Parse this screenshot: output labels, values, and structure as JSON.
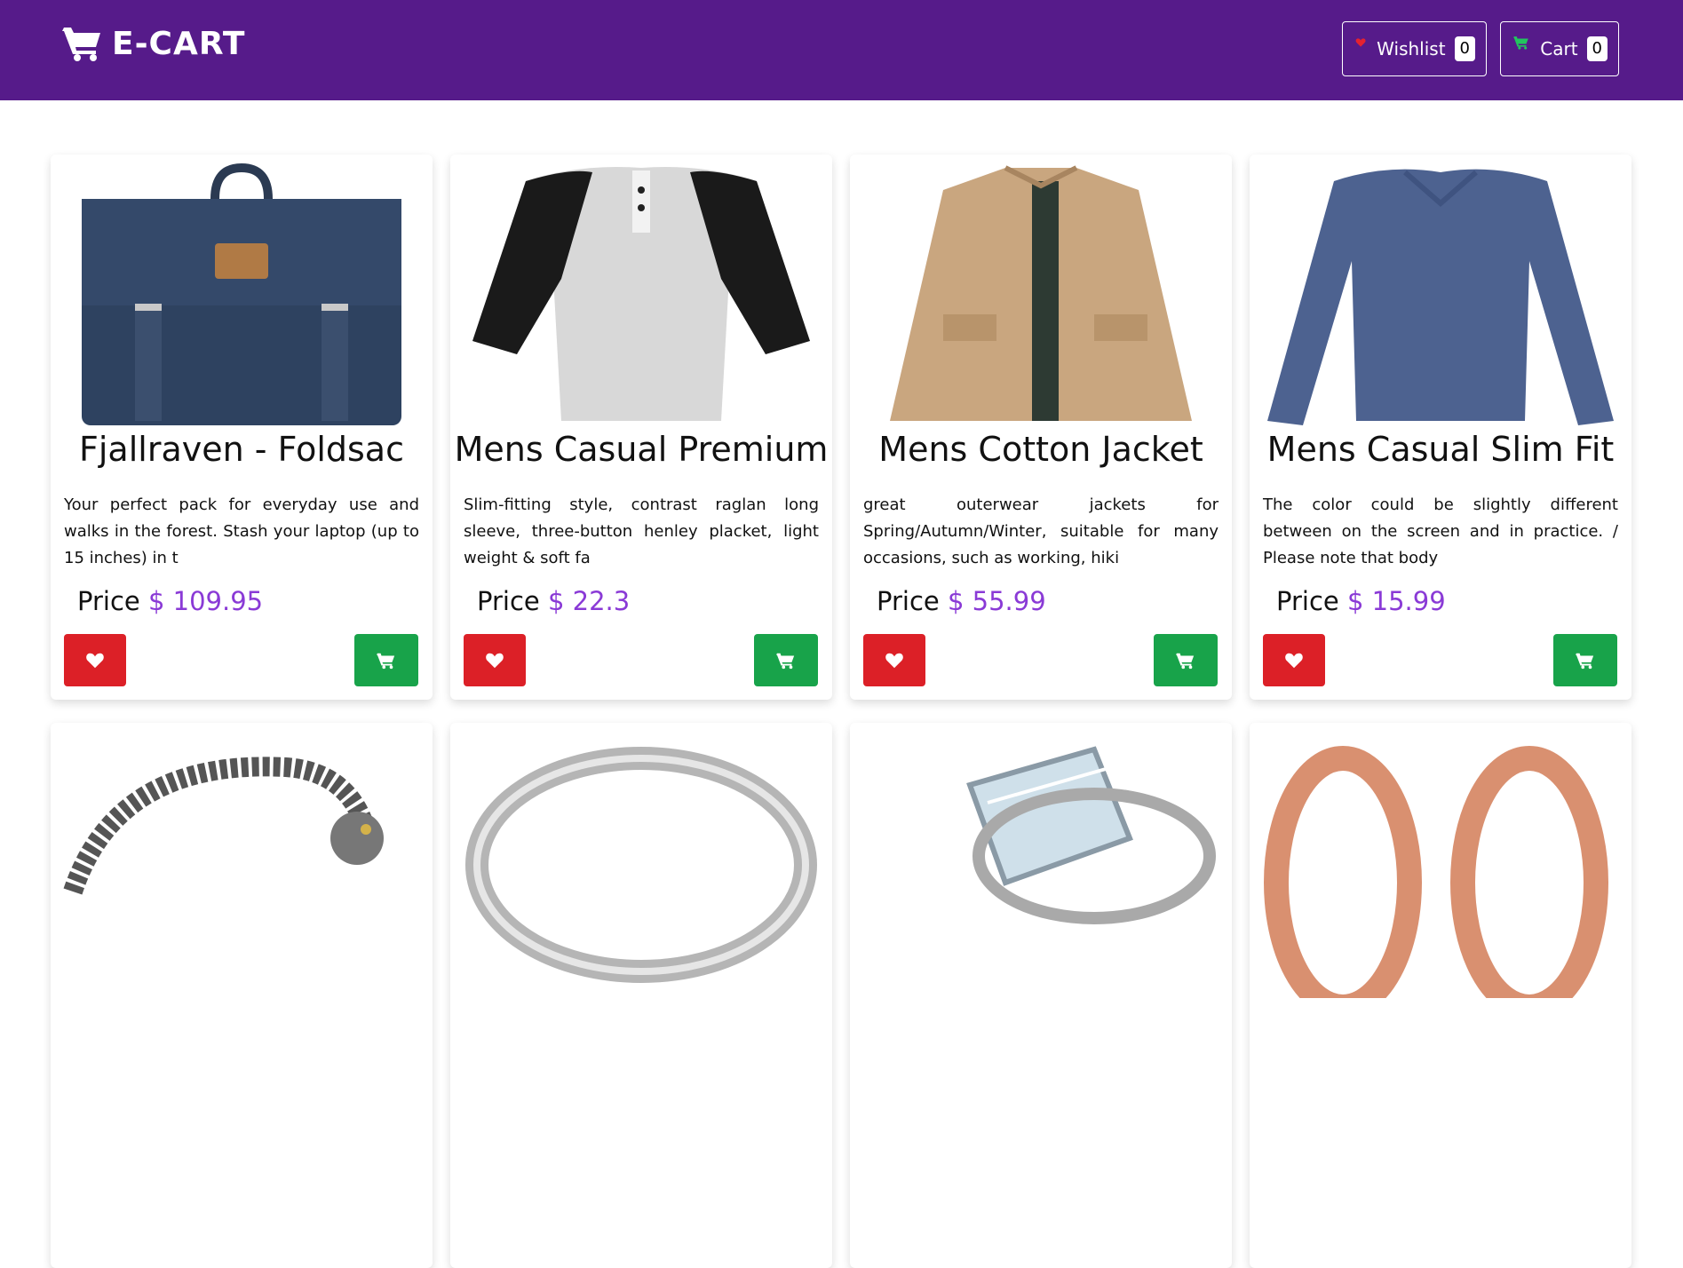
{
  "brand": {
    "name": "E-CART",
    "icon": "shopping-cart-icon"
  },
  "nav": {
    "wishlist": {
      "label": "Wishlist",
      "count": "0",
      "icon": "heart-icon",
      "icon_color": "#e5222f"
    },
    "cart": {
      "label": "Cart",
      "count": "0",
      "icon": "cart-icon",
      "icon_color": "#22c55e"
    }
  },
  "colors": {
    "navbar": "#561b8a",
    "price": "#8a3ad6",
    "wishlist_button": "#dc2027",
    "cart_button": "#18a34a"
  },
  "price_label": "Price",
  "products": [
    {
      "title": "Fjallraven - Foldsac",
      "description": "Your perfect pack for everyday use and walks in the forest. Stash your laptop (up to 15 inches) in t",
      "price": "$ 109.95",
      "image": "backpack"
    },
    {
      "title": "Mens Casual Premium",
      "description": "Slim-fitting style, contrast raglan long sleeve, three-button henley placket, light weight & soft fa",
      "price": "$ 22.3",
      "image": "raglan-shirt"
    },
    {
      "title": "Mens Cotton Jacket",
      "description": "great outerwear jackets for Spring/Autumn/Winter, suitable for many occasions, such as working, hiki",
      "price": "$ 55.99",
      "image": "jacket"
    },
    {
      "title": "Mens Casual Slim Fit",
      "description": "The color could be slightly different between on the screen and in practice. / Please note that body",
      "price": "$ 15.99",
      "image": "long-sleeve-tee"
    },
    {
      "title": "",
      "description": "",
      "price": "",
      "image": "dragon-bracelet"
    },
    {
      "title": "",
      "description": "",
      "price": "",
      "image": "silver-ring"
    },
    {
      "title": "",
      "description": "",
      "price": "",
      "image": "diamond-ring"
    },
    {
      "title": "",
      "description": "",
      "price": "",
      "image": "rose-gold-plugs"
    }
  ]
}
